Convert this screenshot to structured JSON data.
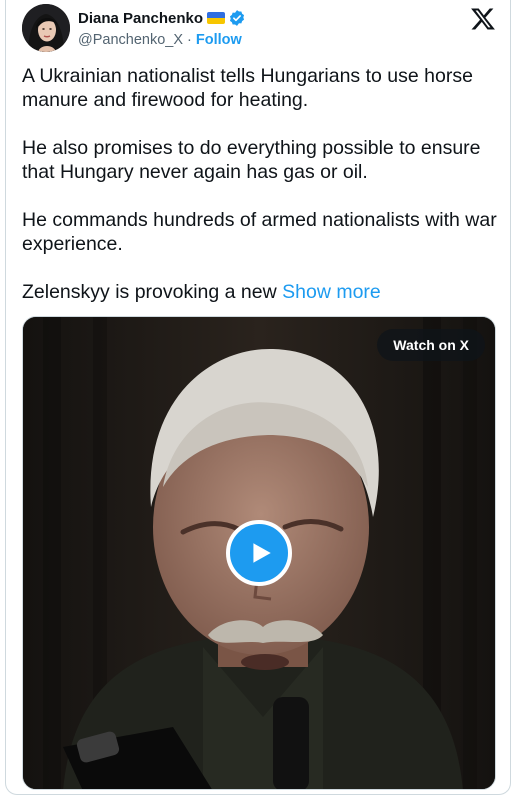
{
  "author": {
    "display_name": "Diana Panchenko",
    "handle": "@Panchenko_X",
    "separator": "·",
    "follow_label": "Follow",
    "flag_colors": [
      "#2f6ee0",
      "#f7c600"
    ],
    "verified_badge_color": "#1d9bf0"
  },
  "tweet": {
    "paragraphs": [
      "A Ukrainian nationalist tells Hungarians to use horse manure and firewood for heating.",
      "He also promises to do everything possible to ensure that Hungary never again has gas or oil.",
      "He commands hundreds of armed nationalists with war experience."
    ],
    "truncated_text": "Zelenskyy is provoking a new",
    "show_more_label": "Show more"
  },
  "media": {
    "watch_label": "Watch on X",
    "play_icon": "play-icon"
  },
  "icons": {
    "platform_logo": "x-logo-icon",
    "verified": "verified-check-icon"
  },
  "colors": {
    "accent": "#1d9bf0",
    "text": "#0f1419",
    "secondary": "#536471"
  }
}
